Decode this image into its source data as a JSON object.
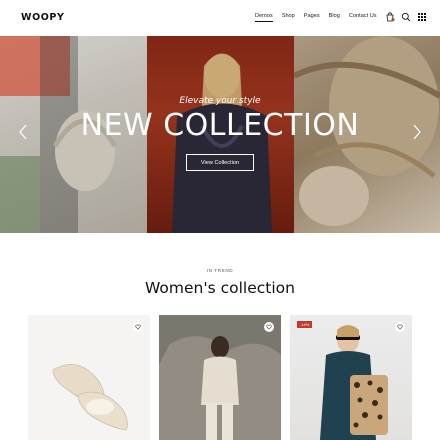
{
  "header": {
    "logo": "WOOPY",
    "nav": [
      "Demos",
      "Shop",
      "Pages",
      "Blog",
      "Contact Us"
    ],
    "active_nav": "Demos",
    "icons": [
      "cart-icon",
      "search-icon",
      "grid-menu-icon"
    ]
  },
  "hero": {
    "kicker": "Elevate your style",
    "title": "NEW COLLECTION",
    "button": "View Collection",
    "arrows": [
      "chevron-left-icon",
      "chevron-right-icon"
    ]
  },
  "section": {
    "kicker": "IN TREND",
    "title": "Women's collection"
  },
  "products": [
    {
      "name": "Beige flats",
      "badge": ""
    },
    {
      "name": "Model in cream outfit",
      "badge": ""
    },
    {
      "name": "Model with leopard bag",
      "badge": "-14%"
    }
  ],
  "colors": {
    "accent": "#111111",
    "badge": "#c0392b",
    "hero_red": "#8b2a17"
  }
}
